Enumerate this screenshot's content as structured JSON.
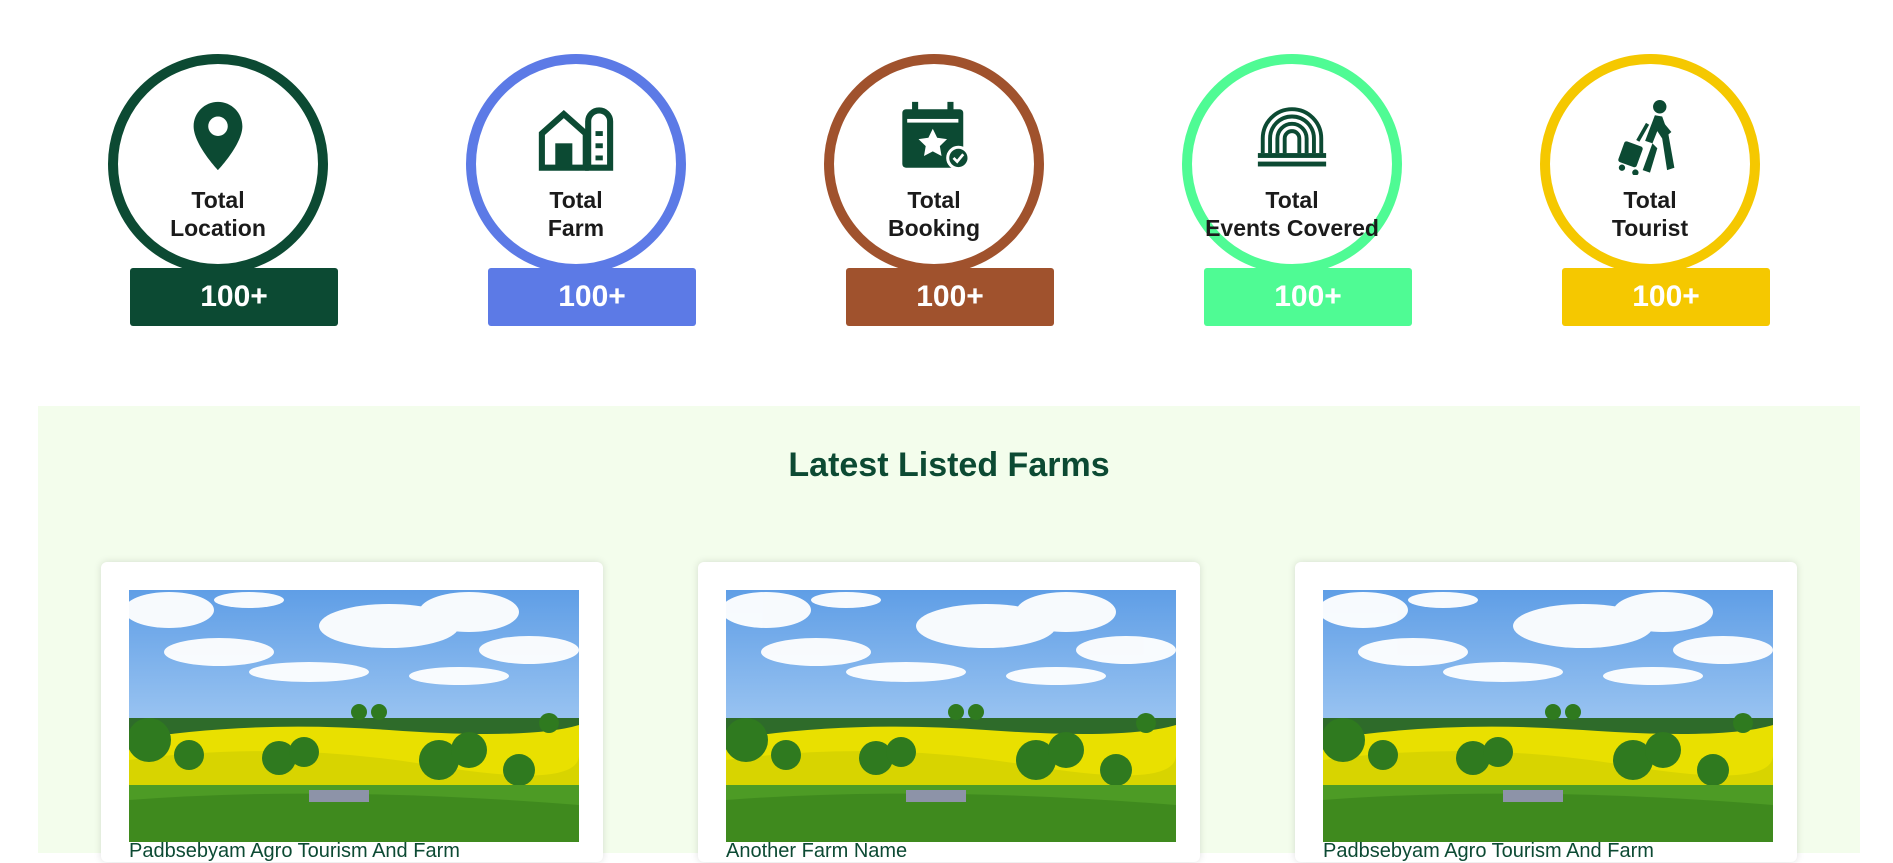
{
  "stats": [
    {
      "line1": "Total",
      "line2": "Location",
      "value": "100+",
      "color": "#0c4a33",
      "icon": "location-pin-icon"
    },
    {
      "line1": "Total",
      "line2": "Farm",
      "value": "100+",
      "color": "#5c7ae6",
      "icon": "farm-barn-icon"
    },
    {
      "line1": "Total",
      "line2": "Booking",
      "value": "100+",
      "color": "#a0522d",
      "icon": "calendar-star-icon"
    },
    {
      "line1": "Total",
      "line2": "Events Covered",
      "value": "100+",
      "color": "#4ffb94",
      "icon": "event-arch-icon"
    },
    {
      "line1": "Total",
      "line2": "Tourist",
      "value": "100+",
      "color": "#f5c800",
      "icon": "traveler-icon"
    }
  ],
  "latest_farms": {
    "title": "Latest Listed Farms",
    "cards": [
      {
        "name": "Padbsebyam Agro Tourism And Farm"
      },
      {
        "name": "Another Farm Name"
      },
      {
        "name": "Padbsebyam Agro Tourism And Farm"
      }
    ]
  },
  "colors": {
    "brand_green": "#0c4a33",
    "section_bg": "#f3fdec"
  }
}
